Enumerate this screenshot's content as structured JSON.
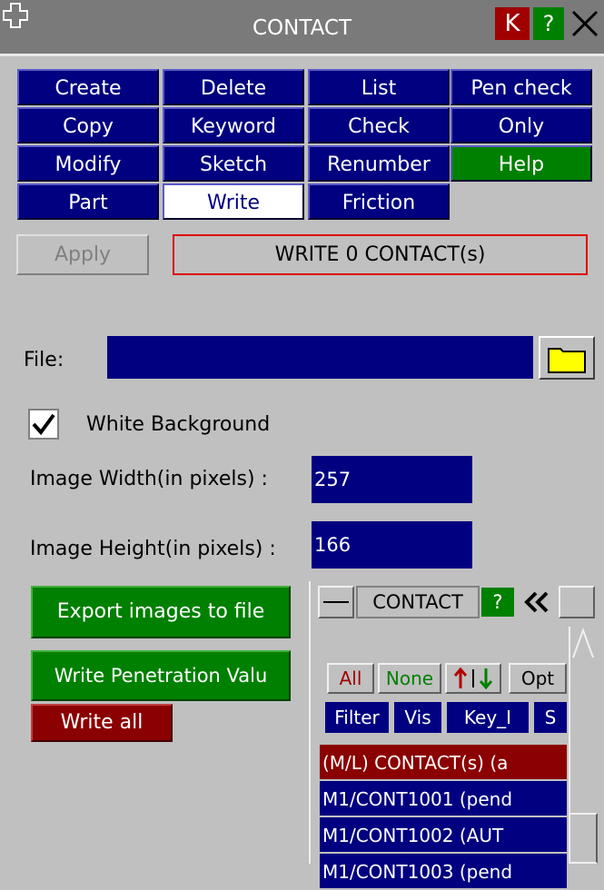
{
  "window": {
    "title": "CONTACT",
    "menu_icon": "plus-cross-icon",
    "btn_k": "K",
    "btn_help": "?",
    "btn_close_icon": "close-x-icon"
  },
  "actions": [
    [
      "Create",
      "Delete",
      "List",
      "Pen check"
    ],
    [
      "Copy",
      "Keyword",
      "Check",
      "Only"
    ],
    [
      "Modify",
      "Sketch",
      "Renumber",
      "Help"
    ],
    [
      "Part",
      "Write",
      "Friction"
    ]
  ],
  "apply": {
    "label": "Apply",
    "status": "WRITE 0 CONTACT(s)"
  },
  "file": {
    "label": "File:",
    "value": "",
    "folder_icon": "folder-icon"
  },
  "white_background": {
    "label": "White Background",
    "checked": true
  },
  "image_width": {
    "label": "Image Width(in pixels) :",
    "value": "257"
  },
  "image_height": {
    "label": "Image Height(in pixels) :",
    "value": "166"
  },
  "export_btn": "Export images to file",
  "write_pen_btn": "Write Penetration Valu",
  "write_all_btn": "Write all",
  "subpanel": {
    "title": "CONTACT",
    "help": "?",
    "collapse_icon": "double-chevron-left-icon",
    "all": "All",
    "none": "None",
    "sort_icon": "sort-arrows-icon",
    "opt": "Opt",
    "filter": "Filter",
    "vis": "Vis",
    "key": "Key_I",
    "s": "S",
    "rows": [
      "(M/L) CONTACT(s) (a",
      "M1/CONT1001 (pend",
      "M1/CONT1002 (AUT",
      "M1/CONT1003 (pend"
    ]
  }
}
